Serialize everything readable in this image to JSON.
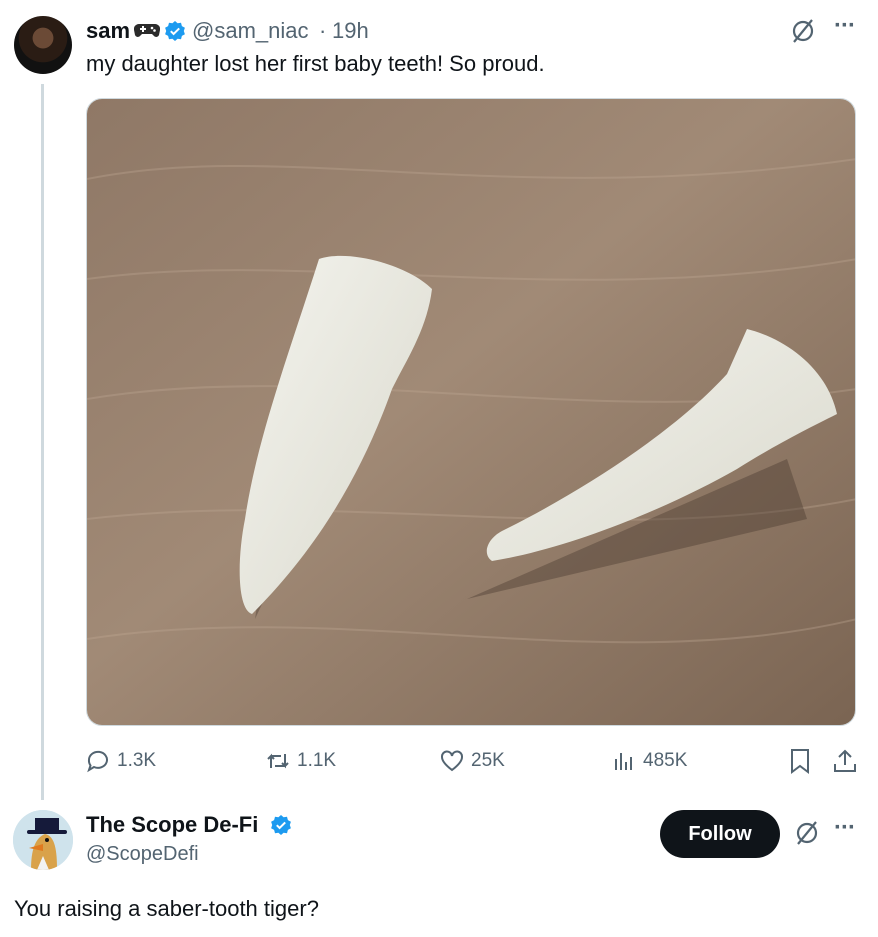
{
  "tweet": {
    "display_name": "sam",
    "name_emoji_icon": "gamepad-icon",
    "handle": "@sam_niac",
    "separator": "·",
    "time": "19h",
    "text": "my daughter lost her first baby teeth! So proud.",
    "media_description_icon": "photo-of-two-teeth",
    "stats": {
      "replies": "1.3K",
      "reposts": "1.1K",
      "likes": "25K",
      "views": "485K"
    },
    "colors": {
      "verified": "#1d9bf0",
      "secondary_text": "#536471"
    }
  },
  "reply": {
    "display_name": "The Scope De-Fi",
    "handle": "@ScopeDefi",
    "follow_label": "Follow",
    "text": "You raising a saber-tooth tiger?"
  }
}
